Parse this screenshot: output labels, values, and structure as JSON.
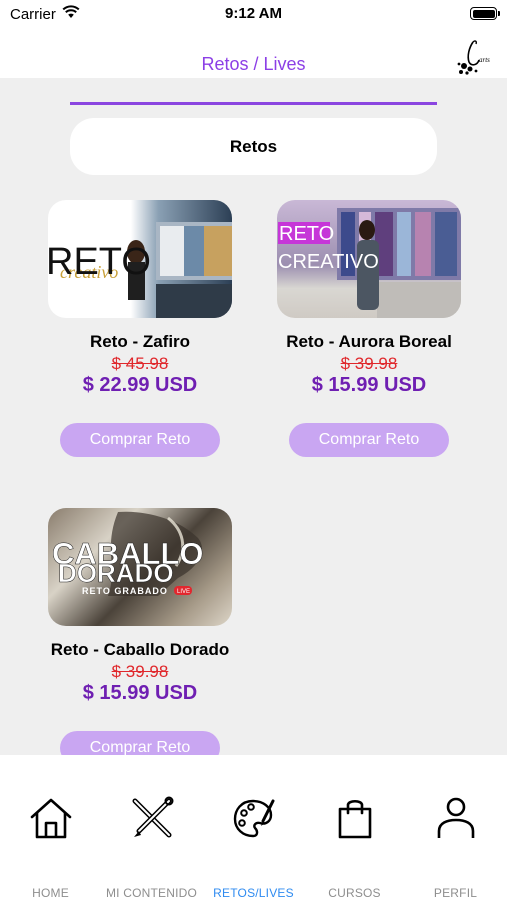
{
  "status_bar": {
    "carrier": "Carrier",
    "time": "9:12 AM"
  },
  "header": {
    "title": "Retos / Lives",
    "logo_icon": "brand-logo-icon"
  },
  "section": {
    "label": "Retos"
  },
  "cards": [
    {
      "thumb_text": "RETO",
      "thumb_script": "creativo",
      "title": "Reto - Zafiro",
      "old_price": "$ 45.98",
      "new_price": "$ 22.99 USD",
      "button": "Comprar Reto"
    },
    {
      "thumb_text": "RETO",
      "thumb_text2": "CREATIVO",
      "title": "Reto - Aurora Boreal",
      "old_price": "$ 39.98",
      "new_price": "$ 15.99 USD",
      "button": "Comprar Reto"
    },
    {
      "thumb_text": "CABALLO",
      "thumb_text2": "DORADO",
      "thumb_text3": "RETO GRABADO",
      "thumb_badge": "LIVE",
      "title": "Reto - Caballo Dorado",
      "old_price": "$ 39.98",
      "new_price": "$ 15.99 USD",
      "button": "Comprar Reto"
    }
  ],
  "tabs": [
    {
      "label": "HOME",
      "icon": "home-icon",
      "active": false
    },
    {
      "label": "MI CONTENIDO",
      "icon": "brushes-icon",
      "active": false
    },
    {
      "label": "RETOS/LIVES",
      "icon": "palette-icon",
      "active": true
    },
    {
      "label": "CURSOS",
      "icon": "shopping-bag-icon",
      "active": false
    },
    {
      "label": "PERFIL",
      "icon": "person-icon",
      "active": false
    }
  ],
  "colors": {
    "accent": "#8c3fe6",
    "price": "#6f1fb2",
    "old_price": "#e0282c",
    "button": "#c9a6f2",
    "tab_active": "#2f8bf0"
  }
}
